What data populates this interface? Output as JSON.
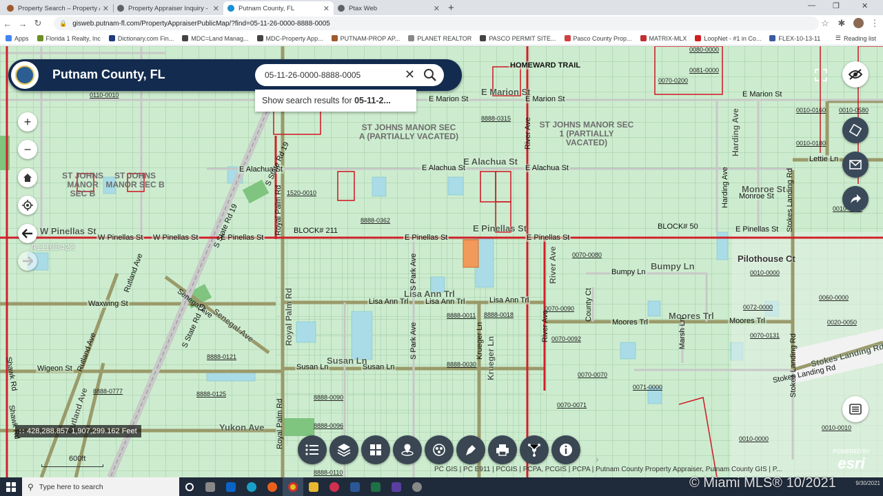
{
  "browser": {
    "tabs": [
      {
        "title": "Property Search – Property Appr",
        "color": "#a05a2c"
      },
      {
        "title": "Property Appraiser Inquiry - Putn",
        "color": "#5f6368"
      },
      {
        "title": "Putnam County, FL",
        "color": "#1a8fd1"
      },
      {
        "title": "Ptax Web",
        "color": "#5f6368"
      }
    ],
    "url": "gisweb.putnam-fl.com/PropertyAppraiserPublicMap/?find=05-11-26-0000-8888-0005",
    "bookmarks": [
      "Apps",
      "Florida 1 Realty, Inc",
      "Dictionary.com Fin...",
      "MDC=Land Manag...",
      "MDC-Property App...",
      "PUTNAM-PROP AP...",
      "PLANET REALTOR",
      "PASCO PERMIT SITE...",
      "Pasco County Prop...",
      "MATRIX-MLX",
      "LoopNet - #1 in Co...",
      "FLEX-10-13-11"
    ],
    "reading_list": "Reading list"
  },
  "app": {
    "title": "Putnam County, FL",
    "search_value": "05-11-26-0000-8888-0005",
    "suggest_prefix": "Show search results for ",
    "suggest_term": "05-11-2..."
  },
  "map": {
    "subdivisions": [
      {
        "text": "ST JOHNS MANOR SEC A (PARTIALLY VACATED)",
        "l1": "ST JOHNS MANOR SEC",
        "l2": "A (PARTIALLY VACATED)"
      },
      {
        "text": "ST JOHNS MANOR SEC 1 (PARTIALLY VACATED)",
        "l1": "ST JOHNS MANOR SEC",
        "l2": "1 (PARTIALLY",
        "l3": "VACATED)"
      },
      {
        "l1": "ST JOHNS",
        "l2": "MANOR",
        "l3": "SEC B"
      },
      {
        "l1": "ST JOHNS",
        "l2": "MANOR SEC B"
      }
    ],
    "roads": {
      "homeward": "HOMEWARD TRAIL",
      "e_marion": "E Marion St",
      "e_alachua": "E Alachua St",
      "e_pinellas": "E Pinellas St",
      "w_pinellas": "W Pinellas St",
      "lisa_ann": "Lisa Ann Trl",
      "bumpy": "Bumpy Ln",
      "moores": "Moores Trl",
      "waxwing": "Waxwing St",
      "wigeon": "Wigeon St",
      "susan": "Susan Ln",
      "yukon": "Yukon Ave",
      "pilothouse": "Pilothouse Ct",
      "monroe": "Monroe St",
      "lettie": "Lettie Ln",
      "stokes": "Stokes Landing Rd",
      "state_rd19": "S State Rd 19",
      "royal_palm": "Royal Palm Rd",
      "river": "River Ave",
      "s_park": "S Park Ave",
      "krueger": "Krueger Ln",
      "harding": "Harding Ave",
      "senegal": "Senegal Ave",
      "rutland": "Rutland Ave",
      "shawk": "Shawk Rd",
      "marsh": "Marsh Ln",
      "county": "County Ct"
    },
    "codes": [
      "0110-0010",
      "1520-0010",
      "8888-0315",
      "8888-0362",
      "0070-0080",
      "0070-0090",
      "0070-0092",
      "0070-0070",
      "0070-0071",
      "0071-0000",
      "0010-0000",
      "0072-0000",
      "0070-0131",
      "0060-0000",
      "0020-0050",
      "0010-0160",
      "0010-0180",
      "0010-0230",
      "0080-0000",
      "0081-0000",
      "0070-0200",
      "8888-0121",
      "8888-0125",
      "8888-0777",
      "8888-0096",
      "8888-0110",
      "8888-0011",
      "8888-0018",
      "8888-0030",
      "8888-0090",
      "0010-0010",
      "0010-0580"
    ],
    "blocks": [
      "BLOCK# 211",
      "BLOCK# 50"
    ],
    "coords": "428,288.857 1,907,299.162 Feet",
    "scale_label": "600ft",
    "mls_id": "A11105423",
    "attribution": "PC GIS | PC E911 | PCGIS | PCPA, PCGIS | PCPA | Putnam County Property Appraiser, Putnam County GIS | P...",
    "esri_powered": "POWERED BY",
    "esri_name": "esri"
  },
  "taskbar": {
    "search_placeholder": "Type here to search",
    "watermark": "© Miami MLS® 10/2021",
    "tray_time": "9/30/2021"
  },
  "colors": {
    "map_bg": "#cdeccf",
    "parcel_line": "#8fbf95",
    "road_red": "#d0202a",
    "road_olive": "#9a9a6a",
    "selected_parcel": "#f29a5a",
    "header_navy": "#132b4f"
  }
}
